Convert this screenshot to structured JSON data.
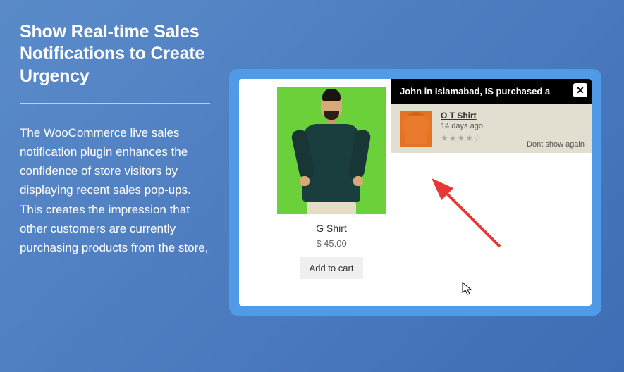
{
  "headline": "Show Real-time Sales Notifications to Create Urgency",
  "body_copy": "The WooCommerce live sales notification plugin enhances the confidence of store visitors by displaying recent sales pop-ups. This creates the impression that other customers are currently purchasing products from the store,",
  "preview": {
    "product": {
      "title": "G Shirt",
      "price": "$ 45.00",
      "add_to_cart_label": "Add to cart"
    },
    "notification": {
      "header": "John in Islamabad, IS purchased a",
      "product_title": "O T Shirt",
      "time_ago": "14 days ago",
      "rating_stars": "★★★★☆",
      "dont_show_label": "Dont show again",
      "close_glyph": "✕"
    }
  },
  "colors": {
    "bg_gradient_from": "#5a8bc9",
    "bg_gradient_to": "#3f6db5",
    "frame": "#4f9be8",
    "product_bg": "#6bd13b",
    "notif_body": "#e2dfd0",
    "tshirt": "#e57324",
    "arrow": "#e53935"
  }
}
